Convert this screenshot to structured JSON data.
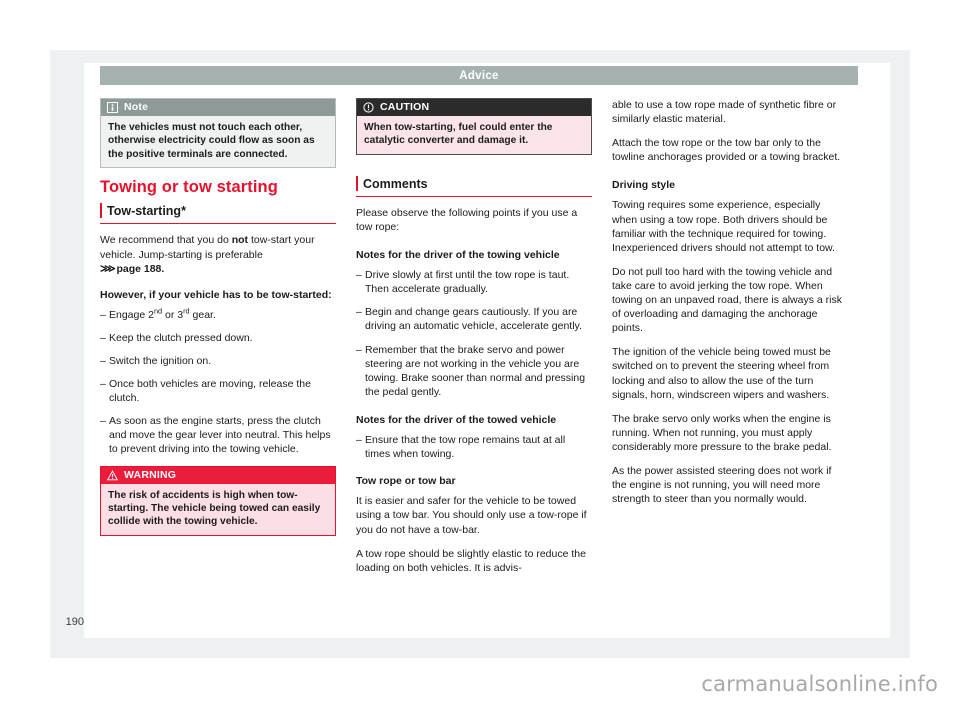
{
  "page": {
    "chapter_title": "Advice",
    "folio": "190",
    "watermark": "carmanualsonline.info",
    "accent_red": "#e8112d",
    "chapter_bar_color": "#a5b2b0"
  },
  "column_left": {
    "note_box": {
      "icon": "info-icon",
      "title": "Note",
      "body": "The vehicles must not touch each other, otherwise electricity could flow as soon as the positive terminals are connected."
    },
    "section_title": "Towing or tow starting",
    "subsection_title": "Tow-starting*",
    "intro_before_bold": "We recommend that you do ",
    "intro_bold": "not",
    "intro_after_bold": " tow-start your vehicle. Jump-starting is preferable",
    "page_ref_arrow": "⋙",
    "page_ref_text": "page 188.",
    "however_heading": "However, if your vehicle has to be tow-started:",
    "steps": [
      {
        "pre": "Engage 2",
        "sup1": "nd",
        "mid": " or 3",
        "sup2": "rd",
        "post": " gear."
      },
      {
        "pre": "Keep the clutch pressed down."
      },
      {
        "pre": "Switch the ignition on."
      },
      {
        "pre": "Once both vehicles are moving, release the clutch."
      },
      {
        "pre": "As soon as the engine starts, press the clutch and move the gear lever into neutral. This helps to prevent driving into the towing vehicle."
      }
    ],
    "warning_box": {
      "icon": "warning-triangle-icon",
      "title": "WARNING",
      "body": "The risk of accidents is high when tow-starting. The vehicle being towed can easily collide with the towing vehicle."
    }
  },
  "column_middle": {
    "caution_box": {
      "icon": "exclamation-circle-icon",
      "title": "CAUTION",
      "body": "When tow-starting, fuel could enter the catalytic converter and damage it."
    },
    "subsection_title": "Comments",
    "intro": "Please observe the following points if you use a tow rope:",
    "towing_heading": "Notes for the driver of the towing vehicle",
    "towing_points": [
      "Drive slowly at first until the tow rope is taut. Then accelerate gradually.",
      "Begin and change gears cautiously. If you are driving an automatic vehicle, accelerate gently.",
      "Remember that the brake servo and power steering are not working in the vehicle you are towing. Brake sooner than normal and pressing the pedal gently."
    ],
    "towed_heading": "Notes for the driver of the towed vehicle",
    "towed_points": [
      "Ensure that the tow rope remains taut at all times when towing."
    ],
    "tow_rope_heading": "Tow rope or tow bar",
    "tow_rope_para_1": "It is easier and safer for the vehicle to be towed using a tow bar. You should only use a tow-rope if you do not have a tow-bar.",
    "tow_rope_para_2": "A tow rope should be slightly elastic to reduce the loading on both vehicles. It is advis-"
  },
  "column_right": {
    "continued_para": "able to use a tow rope made of synthetic fibre or similarly elastic material.",
    "attach_para": "Attach the tow rope or the tow bar only to the towline anchorages provided or a towing bracket.",
    "driving_style_heading": "Driving style",
    "driving_style_paras": [
      "Towing requires some experience, especially when using a tow rope. Both drivers should be familiar with the technique required for towing. Inexperienced drivers should not attempt to tow.",
      "Do not pull too hard with the towing vehicle and take care to avoid jerking the tow rope. When towing on an unpaved road, there is always a risk of overloading and damaging the anchorage points.",
      "The ignition of the vehicle being towed must be switched on to prevent the steering wheel from locking and also to allow the use of the turn signals, horn, windscreen wipers and washers.",
      "The brake servo only works when the engine is running. When not running, you must apply considerably more pressure to the brake pedal.",
      "As the power assisted steering does not work if the engine is not running, you will need more strength to steer than you normally would."
    ]
  }
}
